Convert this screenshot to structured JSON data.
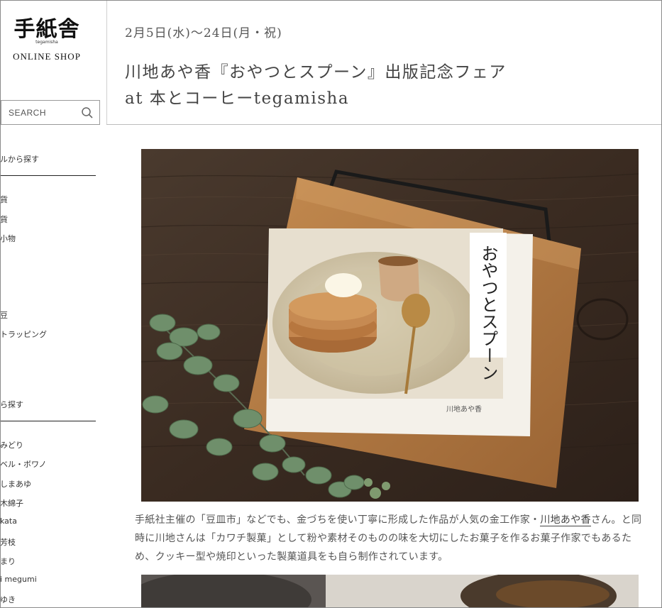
{
  "logo": {
    "kanji": "手紙舎",
    "roman": "tegamisha",
    "sub": "ONLINE SHOP"
  },
  "search": {
    "placeholder": "SEARCH"
  },
  "sidebar": {
    "section1": "ルから探す",
    "items1": [
      "貨",
      "貨",
      "小物",
      "豆",
      "トラッピング"
    ],
    "section2": "ら探す",
    "items2": [
      "みどり",
      "ベル・ボワノ",
      "しまあゆ",
      "木綿子",
      "kata",
      "芳枝",
      "まり",
      "i megumi",
      "ゆき"
    ]
  },
  "article": {
    "date": "2月5日(水)〜24日(月・祝)",
    "title_line1": "川地あや香『おやつとスプーン』出版記念フェア",
    "title_line2": "at 本とコーヒーtegamisha",
    "hero_book_title": "おやつとスプーン",
    "hero_signature": "川地あや香",
    "body_pre": "手紙社主催の「豆皿市」などでも、金づちを使い丁寧に形成した作品が人気の金工作家・",
    "body_link": "川地あや香",
    "body_post": "さん。と同時に川地さんは「カワチ製菓」として粉や素材そのものの味を大切にしたお菓子を作るお菓子作家でもあるため、クッキー型や焼印といった製菓道具をも自ら制作されています。"
  },
  "colors": {
    "wood_dark": "#3a2a20",
    "board": "#b07a44",
    "eucalyptus": "#6f8f6b",
    "plate": "#d9cfb6",
    "pancake": "#c58a52"
  }
}
